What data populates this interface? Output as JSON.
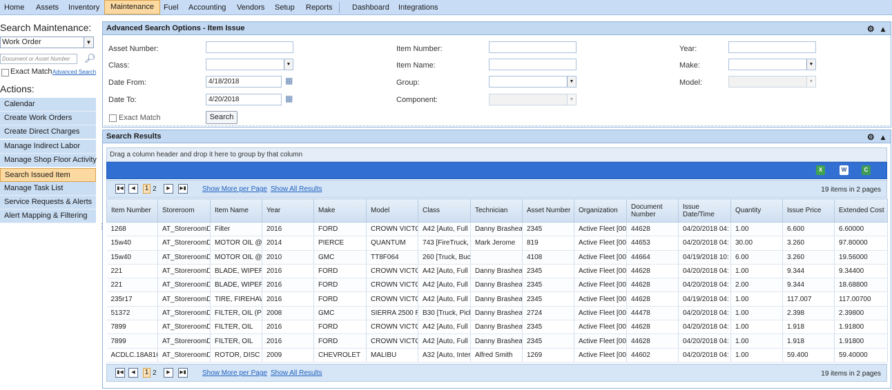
{
  "nav": {
    "items": [
      "Home",
      "Assets",
      "Inventory",
      "Maintenance",
      "Fuel",
      "Accounting",
      "Vendors",
      "Setup",
      "Reports",
      "Dashboard",
      "Integrations"
    ],
    "active": "Maintenance"
  },
  "sidebar": {
    "search_title": "Search Maintenance:",
    "search_type": "Work Order",
    "search_placeholder": "Document or Asset Number",
    "exact_match": "Exact Match",
    "advanced_search": "Advanced Search",
    "actions_title": "Actions:",
    "actions": [
      "Calendar",
      "Create Work Orders",
      "Create Direct Charges",
      "Manage Indirect Labor",
      "Manage Shop Floor Activity",
      "Search Issued Item",
      "Manage Task List",
      "Service Requests & Alerts",
      "Alert Mapping & Filtering"
    ],
    "active_action": "Search Issued Item"
  },
  "search_panel": {
    "title": "Advanced Search Options - Item Issue",
    "labels": {
      "asset_number": "Asset Number:",
      "class": "Class:",
      "date_from": "Date From:",
      "date_to": "Date To:",
      "item_number": "Item Number:",
      "item_name": "Item Name:",
      "group": "Group:",
      "component": "Component:",
      "year": "Year:",
      "make": "Make:",
      "model": "Model:"
    },
    "values": {
      "date_from": "4/18/2018",
      "date_to": "4/20/2018"
    },
    "exact_match": "Exact Match",
    "search_button": "Search"
  },
  "results_panel": {
    "title": "Search Results",
    "group_hint": "Drag a column header and drop it here to group by that column",
    "pager": {
      "current_page": "1",
      "next_page": "2",
      "show_more": "Show More per Page",
      "show_all": "Show All Results",
      "info": "19 items in 2 pages"
    },
    "columns": [
      "Item Number",
      "Storeroom",
      "Item Name",
      "Year",
      "Make",
      "Model",
      "Class",
      "Technician",
      "Asset Number",
      "Organization",
      "Document Number",
      "Issue Date/Time",
      "Quantity",
      "Issue Price",
      "Extended Cost"
    ],
    "rows": [
      [
        "1268",
        "AT_StoreroomD",
        "Filter",
        "2016",
        "FORD",
        "CROWN VICTO",
        "A42 [Auto, Full",
        "Danny Brashear",
        "2345",
        "Active Fleet [00",
        "44628",
        "04/20/2018 04:",
        "1.00",
        "6.600",
        "6.60000"
      ],
      [
        "15w40",
        "AT_StoreroomD",
        "MOTOR OIL @",
        "2014",
        "PIERCE",
        "QUANTUM",
        "743 [FireTruck,",
        "Mark Jerome",
        "819",
        "Active Fleet [00",
        "44653",
        "04/20/2018 04:",
        "30.00",
        "3.260",
        "97.80000"
      ],
      [
        "15w40",
        "AT_StoreroomD",
        "MOTOR OIL @",
        "2010",
        "GMC",
        "TT8F064",
        "260 [Truck, Buc",
        "",
        "4108",
        "Active Fleet [00",
        "44664",
        "04/19/2018 10:",
        "6.00",
        "3.260",
        "19.56000"
      ],
      [
        "221",
        "AT_StoreroomD",
        "BLADE, WIPER -",
        "2016",
        "FORD",
        "CROWN VICTO",
        "A42 [Auto, Full",
        "Danny Brashear",
        "2345",
        "Active Fleet [00",
        "44628",
        "04/20/2018 04:",
        "1.00",
        "9.344",
        "9.34400"
      ],
      [
        "221",
        "AT_StoreroomD",
        "BLADE, WIPER -",
        "2016",
        "FORD",
        "CROWN VICTO",
        "A42 [Auto, Full",
        "Danny Brashear",
        "2345",
        "Active Fleet [00",
        "44628",
        "04/20/2018 04:",
        "2.00",
        "9.344",
        "18.68800"
      ],
      [
        "235r17",
        "AT_StoreroomD",
        "TIRE, FIREHAWI",
        "2016",
        "FORD",
        "CROWN VICTO",
        "A42 [Auto, Full",
        "Danny Brashear",
        "2345",
        "Active Fleet [00",
        "44628",
        "04/19/2018 04:",
        "1.00",
        "117.007",
        "117.00700"
      ],
      [
        "51372",
        "AT_StoreroomD",
        "FILTER, OIL (PH",
        "2008",
        "GMC",
        "SIERRA 2500 RE",
        "B30 [Truck, Pick",
        "Danny Brashear",
        "2724",
        "Active Fleet [00",
        "44478",
        "04/20/2018 04:",
        "1.00",
        "2.398",
        "2.39800"
      ],
      [
        "7899",
        "AT_StoreroomD",
        "FILTER, OIL",
        "2016",
        "FORD",
        "CROWN VICTO",
        "A42 [Auto, Full",
        "Danny Brashear",
        "2345",
        "Active Fleet [00",
        "44628",
        "04/20/2018 04:",
        "1.00",
        "1.918",
        "1.91800"
      ],
      [
        "7899",
        "AT_StoreroomD",
        "FILTER, OIL",
        "2016",
        "FORD",
        "CROWN VICTO",
        "A42 [Auto, Full",
        "Danny Brashear",
        "2345",
        "Active Fleet [00",
        "44628",
        "04/20/2018 04:",
        "1.00",
        "1.918",
        "1.91800"
      ],
      [
        "ACDLC.18A816",
        "AT_StoreroomD",
        "ROTOR, DISC B",
        "2009",
        "CHEVROLET",
        "MALIBU",
        "A32 [Auto, Inter",
        "Alfred Smith",
        "1269",
        "Active Fleet [00",
        "44602",
        "04/20/2018 04:",
        "1.00",
        "59.400",
        "59.40000"
      ]
    ]
  }
}
